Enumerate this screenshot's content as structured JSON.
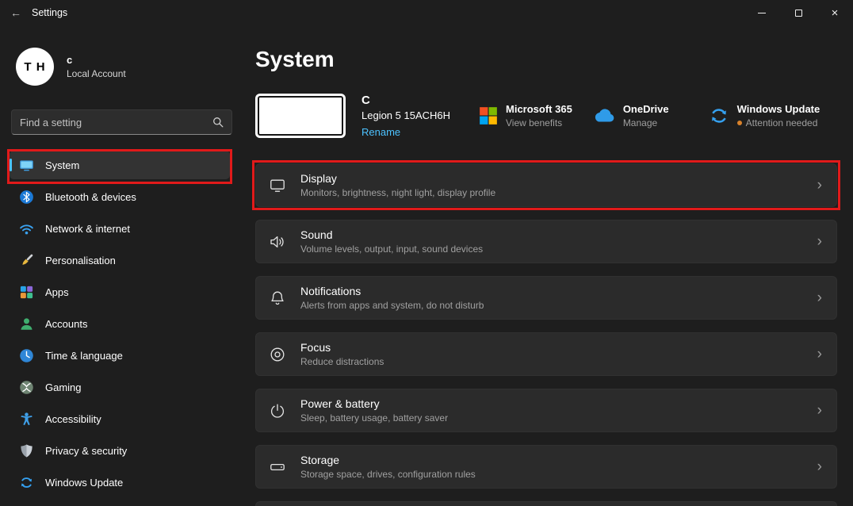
{
  "titlebar": {
    "title": "Settings"
  },
  "icons": {
    "back": "←",
    "close": "×",
    "chevron": "›"
  },
  "user": {
    "initials": "T H",
    "name": "c",
    "account_type": "Local Account"
  },
  "search": {
    "placeholder": "Find a setting"
  },
  "sidebar": {
    "items": [
      {
        "label": "System",
        "selected": true
      },
      {
        "label": "Bluetooth & devices"
      },
      {
        "label": "Network & internet"
      },
      {
        "label": "Personalisation"
      },
      {
        "label": "Apps"
      },
      {
        "label": "Accounts"
      },
      {
        "label": "Time & language"
      },
      {
        "label": "Gaming"
      },
      {
        "label": "Accessibility"
      },
      {
        "label": "Privacy & security"
      },
      {
        "label": "Windows Update"
      }
    ]
  },
  "main": {
    "page_title": "System",
    "device": {
      "name": "C",
      "model": "Legion 5 15ACH6H",
      "rename_label": "Rename"
    },
    "promo_cards": [
      {
        "title": "Microsoft 365",
        "subtitle": "View benefits"
      },
      {
        "title": "OneDrive",
        "subtitle": "Manage"
      },
      {
        "title": "Windows Update",
        "subtitle": "Attention needed"
      }
    ],
    "rows": [
      {
        "title": "Display",
        "subtitle": "Monitors, brightness, night light, display profile",
        "annotated": true
      },
      {
        "title": "Sound",
        "subtitle": "Volume levels, output, input, sound devices"
      },
      {
        "title": "Notifications",
        "subtitle": "Alerts from apps and system, do not disturb"
      },
      {
        "title": "Focus",
        "subtitle": "Reduce distractions"
      },
      {
        "title": "Power & battery",
        "subtitle": "Sleep, battery usage, battery saver"
      },
      {
        "title": "Storage",
        "subtitle": "Storage space, drives, configuration rules"
      }
    ]
  },
  "colors": {
    "accent": "#4cc2ff",
    "annotation": "#e11a1a",
    "attention_dot": "#d9822b",
    "card_background": "#2b2b2b",
    "page_background": "#1e1e1e"
  }
}
